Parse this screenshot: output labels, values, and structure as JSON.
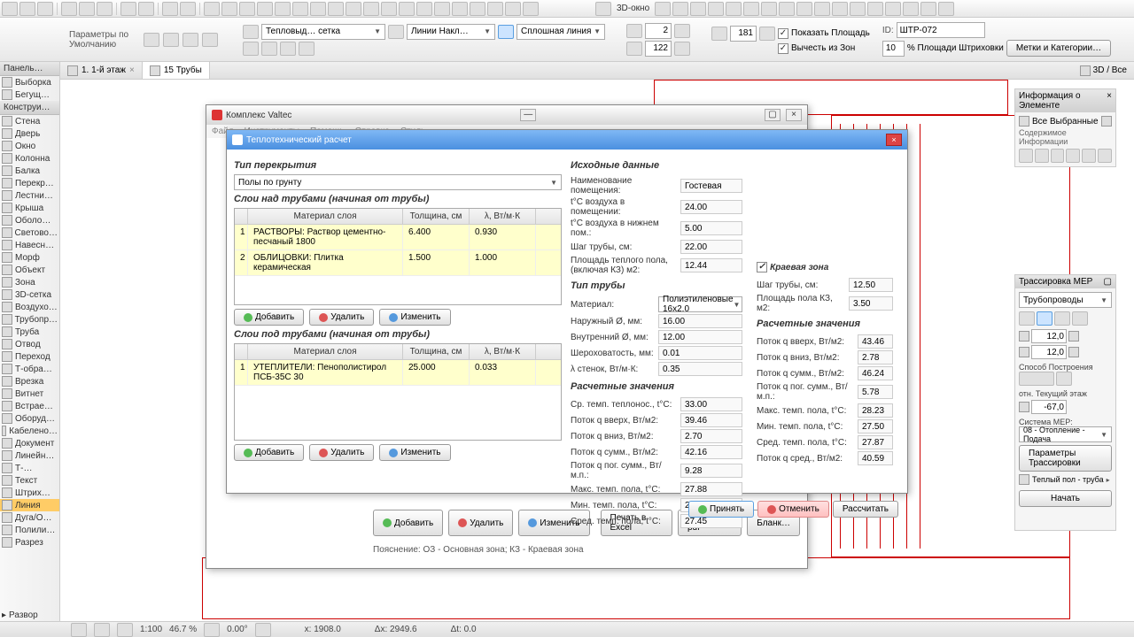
{
  "toolbar": {
    "show_area": "Показать Площадь",
    "exclude_zones": "Вычесть из Зон",
    "hatch_pct": "% Площади Штриховки",
    "val_181": "181",
    "val_2": "2",
    "val_122": "122",
    "val_10": "10",
    "stamp": "ШТР-072",
    "line_style": "Тепловыд… сетка",
    "line_incl": "Линии Накл…",
    "spline": "Сплошная линия",
    "labels_btn": "Метки и Категории…",
    "window_3d": "3D-окно"
  },
  "params_label": "Параметры по Умолчанию",
  "panels": {
    "left_title": "Панель…",
    "konstr_title": "Конструи…"
  },
  "tools": [
    "Выборка",
    "Бегущ…",
    "Стена",
    "Дверь",
    "Окно",
    "Колонна",
    "Балка",
    "Перекр…",
    "Лестни…",
    "Крыша",
    "Оболо…",
    "Светово…",
    "Навесн…",
    "Морф",
    "Объект",
    "Зона",
    "3D-сетка",
    "Воздухо…",
    "Трубопр…",
    "Труба",
    "Отвод",
    "Переход",
    "Т-обра…",
    "Врезка",
    "Витнет",
    "Встрае…",
    "Оборуд…",
    "Кабелено…",
    "Документ",
    "Линейн…",
    "Т-…",
    "Текст",
    "Штрих…",
    "Линия",
    "Дуга/О…",
    "Полили…",
    "Разрез"
  ],
  "selected_tool_index": 33,
  "tabs": {
    "tab1": "1. 1-й этаж",
    "tab2": "15 Трубы",
    "tab2_info": "3D / Все"
  },
  "valtec": {
    "title": "Комплекс Valtec",
    "menu": [
      "Файл",
      "Инструменты",
      "Помощь",
      "Справка",
      "Стиль"
    ]
  },
  "dlg": {
    "title": "Теплотехнический расчет",
    "tip_perekrytiya": "Тип перекрытия",
    "poly_grunt": "Полы по грунту",
    "sloi_nad": "Слои над трубами (начиная от трубы)",
    "sloi_pod": "Слои под трубами (начиная от трубы)",
    "col_material": "Материал слоя",
    "col_thickness": "Толщина, см",
    "col_lambda": "λ, Вт/м·К",
    "rows_above": [
      {
        "n": "1",
        "mat": "РАСТВОРЫ: Раствор цементно-песчаный 1800",
        "th": "6.400",
        "la": "0.930"
      },
      {
        "n": "2",
        "mat": "ОБЛИЦОВКИ: Плитка керамическая",
        "th": "1.500",
        "la": "1.000"
      }
    ],
    "rows_below": [
      {
        "n": "1",
        "mat": "УТЕПЛИТЕЛИ: Пенополистирол ПСБ-35С 30",
        "th": "25.000",
        "la": "0.033"
      }
    ],
    "add": "Добавить",
    "del": "Удалить",
    "edit": "Изменить",
    "ish_dannye": "Исходные данные",
    "fields1": [
      {
        "l": "Наименование помещения:",
        "v": "Гостевая"
      },
      {
        "l": "t°C воздуха в помещении:",
        "v": "24.00"
      },
      {
        "l": "t°C воздуха в нижнем пом.:",
        "v": "5.00"
      },
      {
        "l": "Шаг трубы, см:",
        "v": "22.00"
      },
      {
        "l": "Площадь теплого пола, (включая КЗ) м2:",
        "v": "12.44"
      }
    ],
    "tip_truby": "Тип трубы",
    "truby_fields": [
      {
        "l": "Материал:",
        "v": "Полиэтиленовые 16x2.0",
        "combo": true
      },
      {
        "l": "Наружный Ø, мм:",
        "v": "16.00"
      },
      {
        "l": "Внутренний Ø, мм:",
        "v": "12.00"
      },
      {
        "l": "Шероховатость, мм:",
        "v": "0.01"
      },
      {
        "l": "λ стенок, Вт/м·К:",
        "v": "0.35"
      }
    ],
    "rasch_zn": "Расчетные значения",
    "rasch_fields": [
      {
        "l": "Ср. темп. теплонос., t°C:",
        "v": "33.00"
      },
      {
        "l": "Поток q вверх, Вт/м2:",
        "v": "39.46"
      },
      {
        "l": "Поток q вниз, Вт/м2:",
        "v": "2.70"
      },
      {
        "l": "Поток q сумм., Вт/м2:",
        "v": "42.16"
      },
      {
        "l": "Поток q пог. сумм., Вт/м.п.:",
        "v": "9.28"
      },
      {
        "l": "Макс. темп. пола, t°C:",
        "v": "27.88"
      },
      {
        "l": "Мин. темп. пола, t°C:",
        "v": "27.02"
      },
      {
        "l": "Сред. темп. пола, t°C:",
        "v": "27.45"
      }
    ],
    "kz": "Краевая зона",
    "kz_fields": [
      {
        "l": "Шаг трубы, см:",
        "v": "12.50"
      },
      {
        "l": "Площадь пола КЗ, м2:",
        "v": "3.50"
      }
    ],
    "kz_rasch": [
      {
        "l": "Поток q вверх, Вт/м2:",
        "v": "43.46"
      },
      {
        "l": "Поток q вниз, Вт/м2:",
        "v": "2.78"
      },
      {
        "l": "Поток q сумм., Вт/м2:",
        "v": "46.24"
      },
      {
        "l": "Поток q пог. сумм., Вт/м.п.:",
        "v": "5.78"
      },
      {
        "l": "Макс. темп. пола, t°C:",
        "v": "28.23"
      },
      {
        "l": "Мин. темп. пола, t°C:",
        "v": "27.50"
      },
      {
        "l": "Сред. темп. пола, t°C:",
        "v": "27.87"
      },
      {
        "l": "Поток q сред., Вт/м2:",
        "v": "40.59"
      }
    ],
    "apply": "Принять",
    "cancel": "Отменить",
    "calc": "Рассчитать",
    "print_excel": "Печать в Excel",
    "print_pdf": "Печать в pdf",
    "blank": "Бланк…",
    "note": "Пояснение: ОЗ - Основная зона; КЗ - Краевая зона"
  },
  "right_info": {
    "title": "Информация о Элементе",
    "all_sel": "Все Выбранные",
    "content_info": "Содержимое Информации",
    "mep_title": "Трассировка MEP",
    "pipes": "Трубопроводы",
    "v1": "12,0",
    "v2": "12,0",
    "build_method": "Способ Построения",
    "otn_level": "отн. Текущий этаж",
    "v3": "-67,0",
    "sys_mep": "Система MEP:",
    "sys_val": "08 - Отопление - Подача",
    "trace_params": "Параметры Трассировки",
    "warm_floor": "Теплый пол - труба",
    "start": "Начать"
  },
  "bottom_tool": "Развор",
  "status": {
    "scale": "1:100",
    "zoom": "46.7 %",
    "angle": "0.00°",
    "x": "x: 1908.0",
    "dx": "Δx: 2949.6",
    "dt": "Δt: 0.0"
  }
}
